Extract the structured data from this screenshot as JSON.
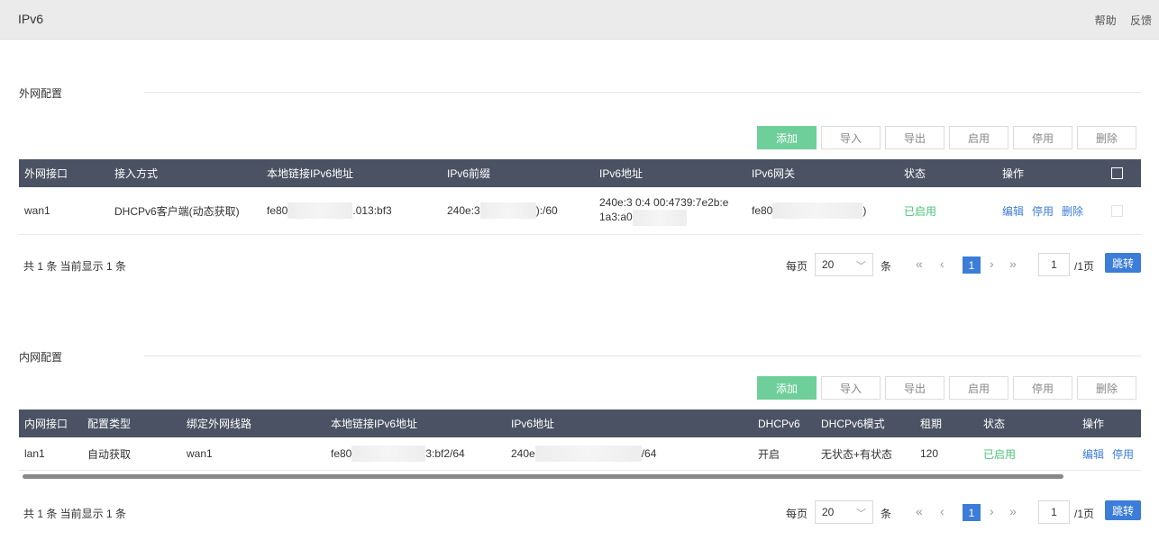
{
  "header": {
    "title": "IPv6",
    "help": "帮助",
    "feedback": "反馈"
  },
  "toolbar": {
    "add": "添加",
    "import": "导入",
    "export": "导出",
    "enable": "启用",
    "disable": "停用",
    "delete": "删除"
  },
  "wan": {
    "section_title": "外网配置",
    "columns": [
      "外网接口",
      "接入方式",
      "本地链接IPv6地址",
      "IPv6前缀",
      "IPv6地址",
      "IPv6网关",
      "状态",
      "操作"
    ],
    "row": {
      "iface": "wan1",
      "mode": "DHCPv6客户端(动态获取)",
      "ll_prefix": "fe80",
      "ll_suffix": ".013:bf3",
      "prefix_a": "240e:3",
      "prefix_b": "):/60",
      "addr_line1": "240e:3  0:4  00:4739:7e2b:e",
      "addr_line2": "1a3:a0",
      "gw_a": "fe80",
      "gw_b": ")",
      "status": "已启用",
      "actions": [
        "编辑",
        "停用",
        "删除"
      ]
    },
    "pager": {
      "summary": "共 1 条 当前显示 1 条",
      "per_page_label": "每页",
      "per_page": "20",
      "unit": "条",
      "current_page": "1",
      "page_input": "1",
      "total_pages": "/1页",
      "go": "跳转"
    }
  },
  "lan": {
    "section_title": "内网配置",
    "columns": [
      "内网接口",
      "配置类型",
      "绑定外网线路",
      "本地链接IPv6地址",
      "IPv6地址",
      "DHCPv6",
      "DHCPv6模式",
      "租期",
      "状态",
      "操作"
    ],
    "row": {
      "iface": "lan1",
      "type": "自动获取",
      "bind": "wan1",
      "ll_prefix": "fe80",
      "ll_suffix": "3:bf2/64",
      "addr_a": "240e",
      "addr_b": "/64",
      "dhcpv6": "开启",
      "dhcpv6_mode": "无状态+有状态",
      "lease": "120",
      "status": "已启用",
      "actions": [
        "编辑",
        "停用"
      ]
    },
    "pager": {
      "summary": "共 1 条 当前显示 1 条",
      "per_page_label": "每页",
      "per_page": "20",
      "unit": "条",
      "current_page": "1",
      "page_input": "1",
      "total_pages": "/1页",
      "go": "跳转"
    }
  }
}
